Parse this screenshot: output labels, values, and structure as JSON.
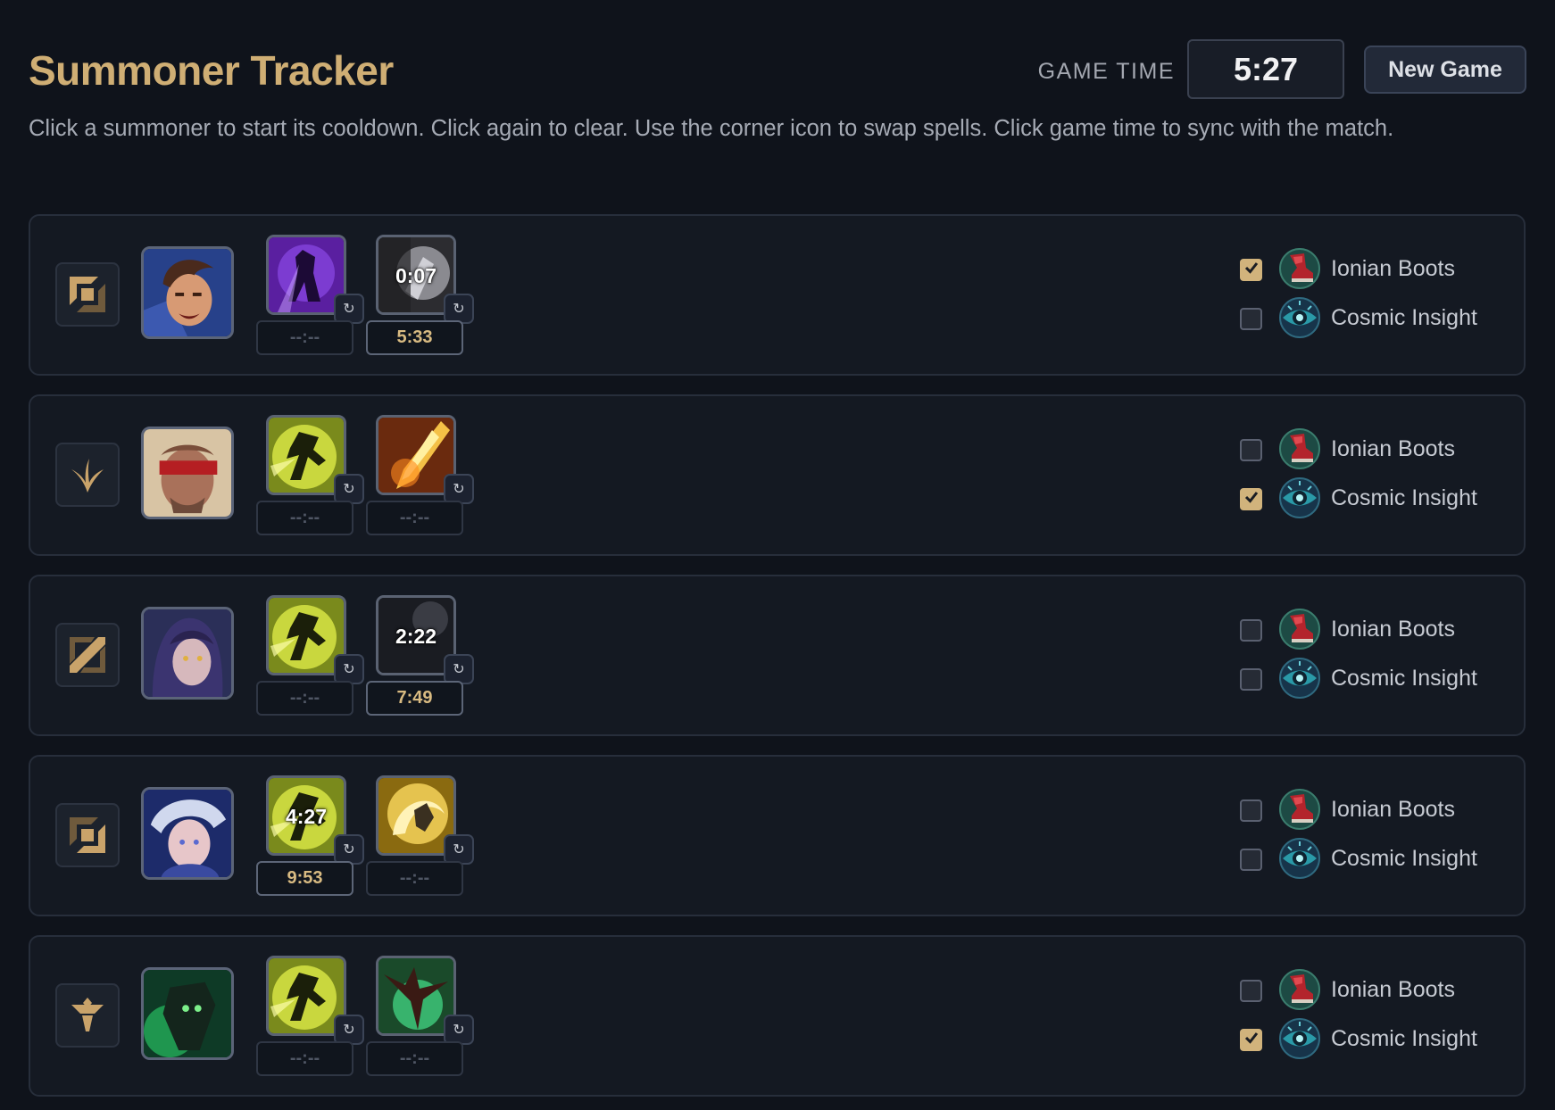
{
  "header": {
    "title": "Summoner Tracker",
    "game_time_label": "GAME TIME",
    "game_time": "5:27",
    "new_game_label": "New Game"
  },
  "instructions": "Click a summoner to start its cooldown. Click again to clear. Use the corner icon to swap spells. Click game time to sync with the match.",
  "swap_glyph": "↻",
  "item_labels": [
    "Ionian Boots",
    "Cosmic Insight"
  ],
  "colors": {
    "accent": "#cfae74",
    "background": "#0f131b",
    "panel": "#141922"
  },
  "rows": [
    {
      "role_icon": "top-lane-icon",
      "champion_icon": "champion-portrait-brown-hair",
      "spells": [
        {
          "icon": "purple-spell-icon",
          "cooldown_overlay": "",
          "timer": "--:--",
          "active": false
        },
        {
          "icon": "grey-spell-icon",
          "cooldown_overlay": "0:07",
          "timer": "5:33",
          "active": true
        }
      ],
      "items": [
        {
          "checked": true
        },
        {
          "checked": false
        }
      ]
    },
    {
      "role_icon": "jungle-icon",
      "champion_icon": "champion-portrait-blindfold",
      "spells": [
        {
          "icon": "flash-spell-icon",
          "cooldown_overlay": "",
          "timer": "--:--",
          "active": false
        },
        {
          "icon": "ignite-spell-icon",
          "cooldown_overlay": "",
          "timer": "--:--",
          "active": false
        }
      ],
      "items": [
        {
          "checked": false
        },
        {
          "checked": true
        }
      ]
    },
    {
      "role_icon": "mid-lane-icon",
      "champion_icon": "champion-portrait-dark-hair",
      "spells": [
        {
          "icon": "flash-spell-icon",
          "cooldown_overlay": "",
          "timer": "--:--",
          "active": false
        },
        {
          "icon": "dark-spell-icon",
          "cooldown_overlay": "2:22",
          "timer": "7:49",
          "active": true
        }
      ],
      "items": [
        {
          "checked": false
        },
        {
          "checked": false
        }
      ]
    },
    {
      "role_icon": "bot-lane-icon",
      "champion_icon": "champion-portrait-white-hair",
      "spells": [
        {
          "icon": "flash-spell-icon",
          "cooldown_overlay": "4:27",
          "timer": "9:53",
          "active": true
        },
        {
          "icon": "heal-spell-icon",
          "cooldown_overlay": "",
          "timer": "--:--",
          "active": false
        }
      ],
      "items": [
        {
          "checked": false
        },
        {
          "checked": false
        }
      ]
    },
    {
      "role_icon": "support-icon",
      "champion_icon": "champion-portrait-green",
      "spells": [
        {
          "icon": "flash-spell-icon",
          "cooldown_overlay": "",
          "timer": "--:--",
          "active": false
        },
        {
          "icon": "green-spell-icon",
          "cooldown_overlay": "",
          "timer": "--:--",
          "active": false
        }
      ],
      "items": [
        {
          "checked": false
        },
        {
          "checked": true
        }
      ]
    }
  ]
}
